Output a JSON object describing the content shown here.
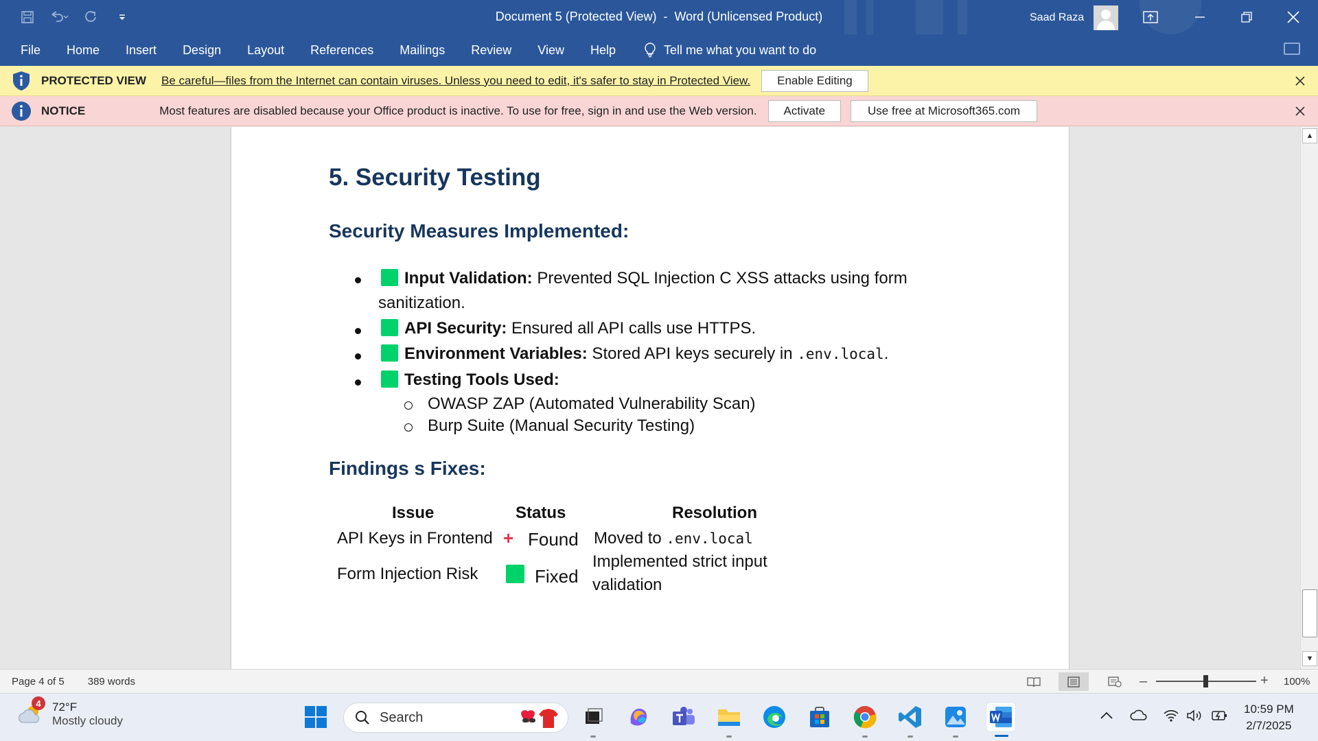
{
  "window": {
    "title": "Document 5 (Protected View)  -  Word (Unlicensed Product)",
    "user_name": "Saad Raza"
  },
  "ribbon": {
    "tabs": [
      "File",
      "Home",
      "Insert",
      "Design",
      "Layout",
      "References",
      "Mailings",
      "Review",
      "View",
      "Help"
    ],
    "tell_me": "Tell me what you want to do"
  },
  "protected_banner": {
    "title": "PROTECTED VIEW",
    "message": "Be careful—files from the Internet can contain viruses. Unless you need to edit, it's safer to stay in Protected View.",
    "button": "Enable Editing"
  },
  "notice_banner": {
    "title": "NOTICE",
    "message": "Most features are disabled because your Office product is inactive. To use for free, sign in and use the Web version.",
    "activate_button": "Activate",
    "web_button": "Use free at Microsoft365.com"
  },
  "document": {
    "heading": "5. Security Testing",
    "section1_title": "Security Measures Implemented:",
    "bullets": [
      {
        "label": "Input Validation:",
        "text": " Prevented SQL Injection C XSS attacks using form",
        "cont": "sanitization."
      },
      {
        "label": "API Security:",
        "text": " Ensured all API calls use HTTPS."
      },
      {
        "label": "Environment Variables:",
        "text": " Stored API keys securely in ",
        "code": ".env.local",
        "after": "."
      },
      {
        "label": "Testing Tools Used:",
        "text": ""
      }
    ],
    "sub_bullets": [
      "OWASP ZAP (Automated Vulnerability Scan)",
      "Burp Suite (Manual Security Testing)"
    ],
    "section2_title": "Findings s Fixes:",
    "table": {
      "headers": [
        "Issue",
        "Status",
        "Resolution"
      ],
      "rows": [
        {
          "issue": "API Keys in Frontend",
          "status": "Found",
          "status_icon": "red-plus",
          "resolution_prefix": "Moved to ",
          "resolution_code": ".env.local"
        },
        {
          "issue": "Form Injection Risk",
          "status": "Fixed",
          "status_icon": "green-square",
          "resolution_line1": "Implemented strict input",
          "resolution_line2": "validation"
        }
      ]
    }
  },
  "status_bar": {
    "page": "Page 4 of 5",
    "words": "389 words",
    "zoom": "100%"
  },
  "taskbar": {
    "weather_temp": "72°F",
    "weather_desc": "Mostly cloudy",
    "weather_badge": "4",
    "search_label": "Search",
    "time": "10:59 PM",
    "date": "2/7/2025"
  },
  "colors": {
    "title_bar": "#2b579a",
    "heading": "#17365d",
    "protected_banner": "#fcf3a8",
    "notice_banner": "#f9d6d5",
    "green_square": "#00d26a",
    "red_plus": "#e8344b"
  }
}
